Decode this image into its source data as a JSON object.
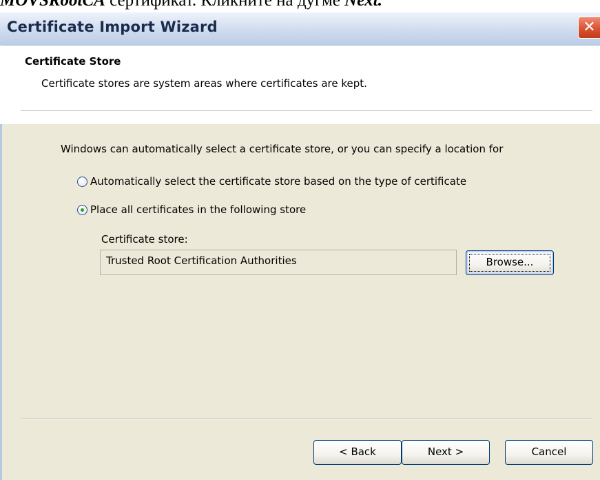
{
  "doc_line": {
    "prefix": "MOVSRootCA",
    "middle": " сертификат. Кликните на дугме ",
    "suffix": "Next."
  },
  "window": {
    "title": "Certificate Import Wizard",
    "close_glyph": "✕"
  },
  "header": {
    "title": "Certificate Store",
    "subtitle": "Certificate stores are system areas where certificates are kept."
  },
  "body": {
    "intro": "Windows can automatically select a certificate store, or you can specify a location for",
    "options": [
      {
        "label": "Automatically select the certificate store based on the type of certificate",
        "selected": false
      },
      {
        "label": "Place all certificates in the following store",
        "selected": true
      }
    ],
    "store_label": "Certificate store:",
    "store_value": "Trusted Root Certification Authorities",
    "browse_label": "Browse..."
  },
  "footer": {
    "back_label": "< Back",
    "next_label": "Next >",
    "cancel_label": "Cancel"
  },
  "colors": {
    "dialog_bg": "#ece9d8",
    "title_text": "#1a2b4c",
    "close_red": "#d9532f",
    "radio_dot": "#2aa02a"
  }
}
